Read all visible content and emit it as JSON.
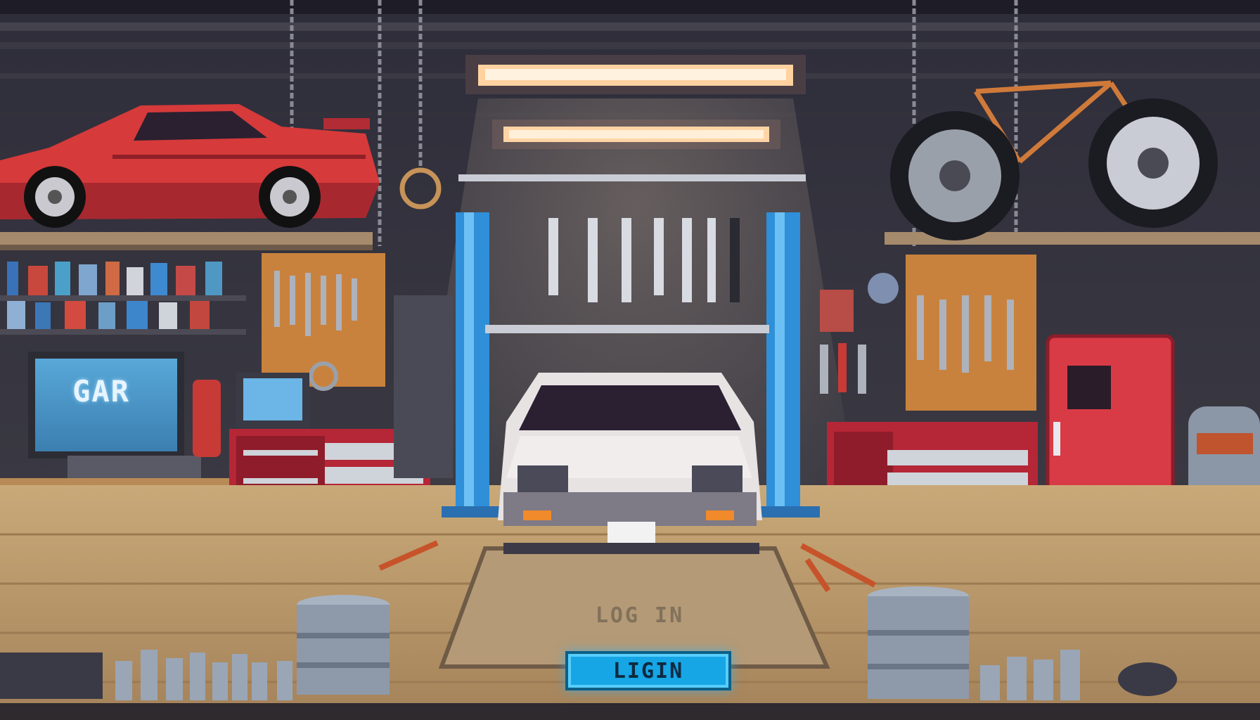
{
  "monitor": {
    "text": "GAR"
  },
  "floor": {
    "text": "LOG IN"
  },
  "login_button": {
    "label": "LIGIN"
  },
  "colors": {
    "accent": "#16a6e6",
    "car_red": "#d63a3a",
    "car_white": "#e7e3e3",
    "lift_blue": "#2f8fd8",
    "pegboard": "#c9823d",
    "toolbox_red": "#b52636",
    "fridge_red": "#d93b46"
  }
}
